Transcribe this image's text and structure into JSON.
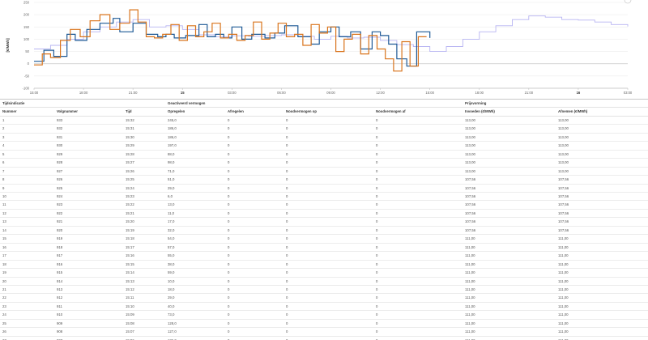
{
  "chart_data": {
    "type": "line",
    "ylabel": "[€/MWh]",
    "ylim": [
      -100,
      250
    ],
    "y_ticks": [
      "250",
      "200",
      "150",
      "100",
      "50",
      "0",
      "-50",
      "-100"
    ],
    "x_ticks": [
      "15:00",
      "18:00",
      "21:00",
      "15",
      "03:00",
      "06:00",
      "09:00",
      "12:00",
      "15:00",
      "18:00",
      "21:00",
      "16",
      "03:00"
    ],
    "x_range_hours": [
      0,
      36
    ],
    "series": [
      {
        "color": "#b7b4f2",
        "x": [
          0,
          1,
          2,
          3,
          4,
          5,
          6,
          7,
          8,
          9,
          10,
          11,
          12,
          13,
          14,
          15,
          16,
          17,
          18,
          19,
          20,
          21,
          22,
          23,
          24,
          25,
          26,
          27,
          28,
          29,
          30,
          31,
          32,
          33,
          34,
          35,
          36
        ],
        "values": [
          60,
          75,
          100,
          130,
          150,
          170,
          180,
          150,
          155,
          140,
          118,
          110,
          114,
          112,
          115,
          118,
          112,
          100,
          112,
          105,
          108,
          95,
          78,
          70,
          50,
          70,
          100,
          130,
          155,
          180,
          195,
          190,
          180,
          178,
          170,
          160,
          152
        ]
      },
      {
        "color": "#1f5a96",
        "x": [
          0,
          0.6,
          1.2,
          2,
          2.5,
          3.2,
          4,
          4.8,
          5.2,
          6,
          6.8,
          7.5,
          8,
          8.5,
          9.2,
          10,
          10.5,
          11,
          11.5,
          12,
          12.6,
          13.2,
          14,
          14.6,
          15.2,
          16,
          16.8,
          17.3,
          18,
          18.5,
          19.2,
          19.8,
          20.5,
          21,
          21.5,
          22,
          22.6,
          23.2,
          24
        ],
        "values": [
          10,
          55,
          30,
          120,
          95,
          140,
          165,
          185,
          130,
          165,
          120,
          110,
          120,
          105,
          115,
          160,
          110,
          120,
          105,
          150,
          100,
          120,
          105,
          125,
          155,
          110,
          80,
          130,
          150,
          110,
          130,
          60,
          130,
          115,
          80,
          20,
          -10,
          130,
          105
        ]
      },
      {
        "color": "#d9741c",
        "x": [
          0,
          0.5,
          1,
          1.6,
          2.2,
          2.8,
          3.4,
          4,
          4.6,
          5.2,
          5.8,
          6.3,
          6.8,
          7.3,
          7.8,
          8.3,
          8.8,
          9.3,
          9.8,
          10.3,
          10.8,
          11.3,
          11.8,
          12.3,
          12.8,
          13.3,
          13.8,
          14.3,
          14.8,
          15.3,
          15.8,
          16.3,
          16.8,
          17.3,
          17.8,
          18.3,
          18.8,
          19.3,
          19.8,
          20.3,
          20.8,
          21.3,
          21.8,
          22.3,
          22.8,
          23.3,
          23.8
        ],
        "values": [
          -5,
          40,
          25,
          95,
          140,
          110,
          175,
          200,
          140,
          165,
          220,
          170,
          110,
          105,
          120,
          160,
          95,
          155,
          110,
          130,
          165,
          105,
          120,
          95,
          115,
          170,
          100,
          125,
          165,
          110,
          120,
          75,
          160,
          125,
          150,
          50,
          100,
          120,
          40,
          115,
          60,
          20,
          -30,
          90,
          -10,
          110,
          110
        ]
      }
    ]
  },
  "table": {
    "group_headers": [
      "Tijdsindicatie",
      "Geactiveerd vermogen",
      "Prijsvorming"
    ],
    "columns": [
      "Nummer",
      "Volgnummer",
      "Tijd",
      "Opregelen",
      "Afregelen",
      "Noodvermogen op",
      "Noodvermogen af",
      "Invoeden (€/MWh)",
      "Afnemen (€/MWh)"
    ],
    "rows": [
      [
        "1",
        "933",
        "15:32",
        "245,0",
        "0",
        "0",
        "0",
        "113,00",
        "113,00"
      ],
      [
        "2",
        "932",
        "15:31",
        "186,0",
        "0",
        "0",
        "0",
        "113,00",
        "113,00"
      ],
      [
        "3",
        "931",
        "15:30",
        "186,0",
        "0",
        "0",
        "0",
        "113,00",
        "113,00"
      ],
      [
        "4",
        "930",
        "15:29",
        "197,0",
        "0",
        "0",
        "0",
        "113,00",
        "113,00"
      ],
      [
        "5",
        "929",
        "15:28",
        "88,0",
        "0",
        "0",
        "0",
        "113,00",
        "113,00"
      ],
      [
        "6",
        "928",
        "15:27",
        "98,0",
        "0",
        "0",
        "0",
        "113,00",
        "113,00"
      ],
      [
        "7",
        "927",
        "15:26",
        "71,0",
        "0",
        "0",
        "0",
        "113,00",
        "113,00"
      ],
      [
        "8",
        "926",
        "15:25",
        "51,0",
        "0",
        "0",
        "0",
        "107,56",
        "107,56"
      ],
      [
        "9",
        "925",
        "15:24",
        "29,0",
        "0",
        "0",
        "0",
        "107,56",
        "107,56"
      ],
      [
        "10",
        "924",
        "15:23",
        "6,0",
        "0",
        "0",
        "0",
        "107,56",
        "107,56"
      ],
      [
        "11",
        "923",
        "15:22",
        "13,0",
        "0",
        "0",
        "0",
        "107,56",
        "107,56"
      ],
      [
        "12",
        "922",
        "15:21",
        "11,0",
        "0",
        "0",
        "0",
        "107,56",
        "107,56"
      ],
      [
        "13",
        "921",
        "15:20",
        "17,0",
        "0",
        "0",
        "0",
        "107,56",
        "107,56"
      ],
      [
        "14",
        "920",
        "15:19",
        "32,0",
        "0",
        "0",
        "0",
        "107,56",
        "107,56"
      ],
      [
        "15",
        "919",
        "15:18",
        "54,0",
        "0",
        "0",
        "0",
        "111,00",
        "111,00"
      ],
      [
        "16",
        "918",
        "15:17",
        "57,0",
        "0",
        "0",
        "0",
        "111,00",
        "111,00"
      ],
      [
        "17",
        "917",
        "15:16",
        "55,0",
        "0",
        "0",
        "0",
        "111,00",
        "111,00"
      ],
      [
        "18",
        "916",
        "15:15",
        "38,0",
        "0",
        "0",
        "0",
        "111,00",
        "111,00"
      ],
      [
        "19",
        "915",
        "15:14",
        "59,0",
        "0",
        "0",
        "0",
        "111,00",
        "111,00"
      ],
      [
        "20",
        "914",
        "15:13",
        "10,0",
        "0",
        "0",
        "0",
        "111,00",
        "111,00"
      ],
      [
        "21",
        "913",
        "15:12",
        "18,0",
        "0",
        "0",
        "0",
        "111,00",
        "111,00"
      ],
      [
        "22",
        "912",
        "15:11",
        "29,0",
        "0",
        "0",
        "0",
        "111,00",
        "111,00"
      ],
      [
        "23",
        "911",
        "15:10",
        "40,0",
        "0",
        "0",
        "0",
        "111,00",
        "111,00"
      ],
      [
        "24",
        "910",
        "15:09",
        "73,0",
        "0",
        "0",
        "0",
        "111,00",
        "111,00"
      ],
      [
        "25",
        "909",
        "15:08",
        "128,0",
        "0",
        "0",
        "0",
        "111,00",
        "111,00"
      ],
      [
        "26",
        "908",
        "15:07",
        "127,0",
        "0",
        "0",
        "0",
        "111,00",
        "111,00"
      ],
      [
        "27",
        "907",
        "15:06",
        "136,0",
        "0",
        "0",
        "0",
        "111,00",
        "111,00"
      ]
    ]
  }
}
